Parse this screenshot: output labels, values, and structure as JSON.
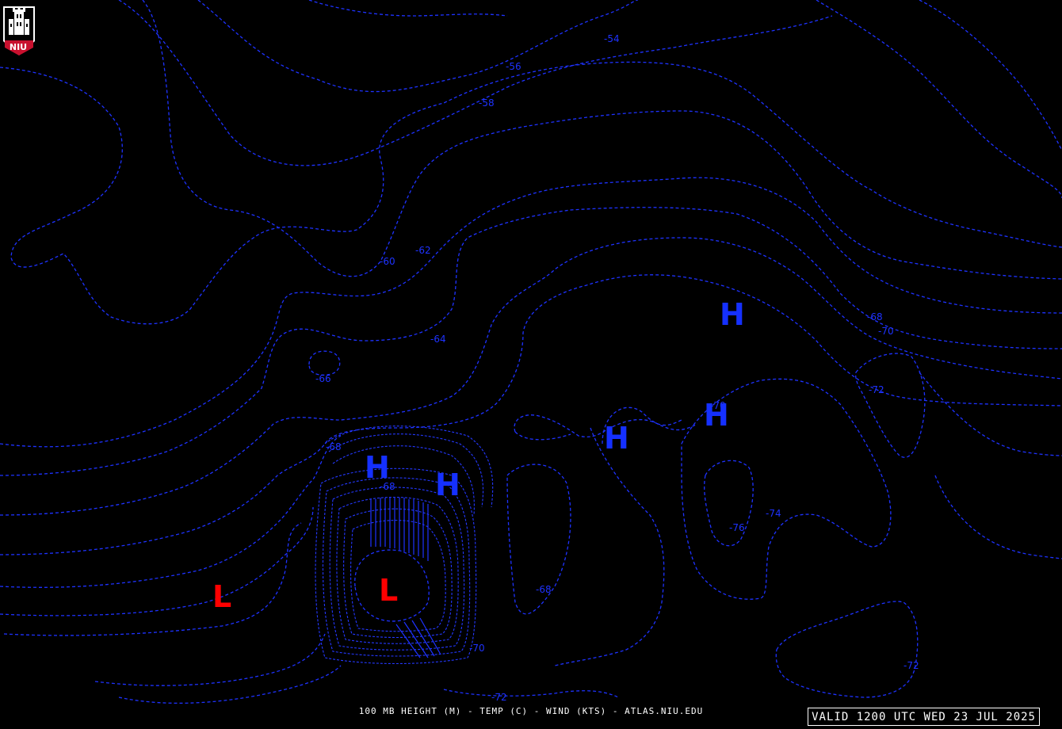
{
  "caption": "100 MB HEIGHT (M) - TEMP (C) - WIND (KTS) - ATLAS.NIU.EDU",
  "valid_time": "VALID 1200 UTC WED 23 JUL 2025",
  "logo": {
    "text": "NIU",
    "icon": "niu-tower-logo"
  },
  "colors": {
    "background": "#000000",
    "contour": "#1e32ff",
    "high": "#1530ff",
    "low": "#ff0000",
    "text": "#ffffff"
  },
  "contour_labels": [
    "-54",
    "-56",
    "-58",
    "-60",
    "-62",
    "-64",
    "-66",
    "-68",
    "-68",
    "-68",
    "-70",
    "-70",
    "-72",
    "-74",
    "-76",
    "-72",
    "-70",
    "-72",
    "-68"
  ],
  "pressure_centers": {
    "high_label": "H",
    "low_label": "L",
    "highs": 5,
    "lows": 2
  }
}
